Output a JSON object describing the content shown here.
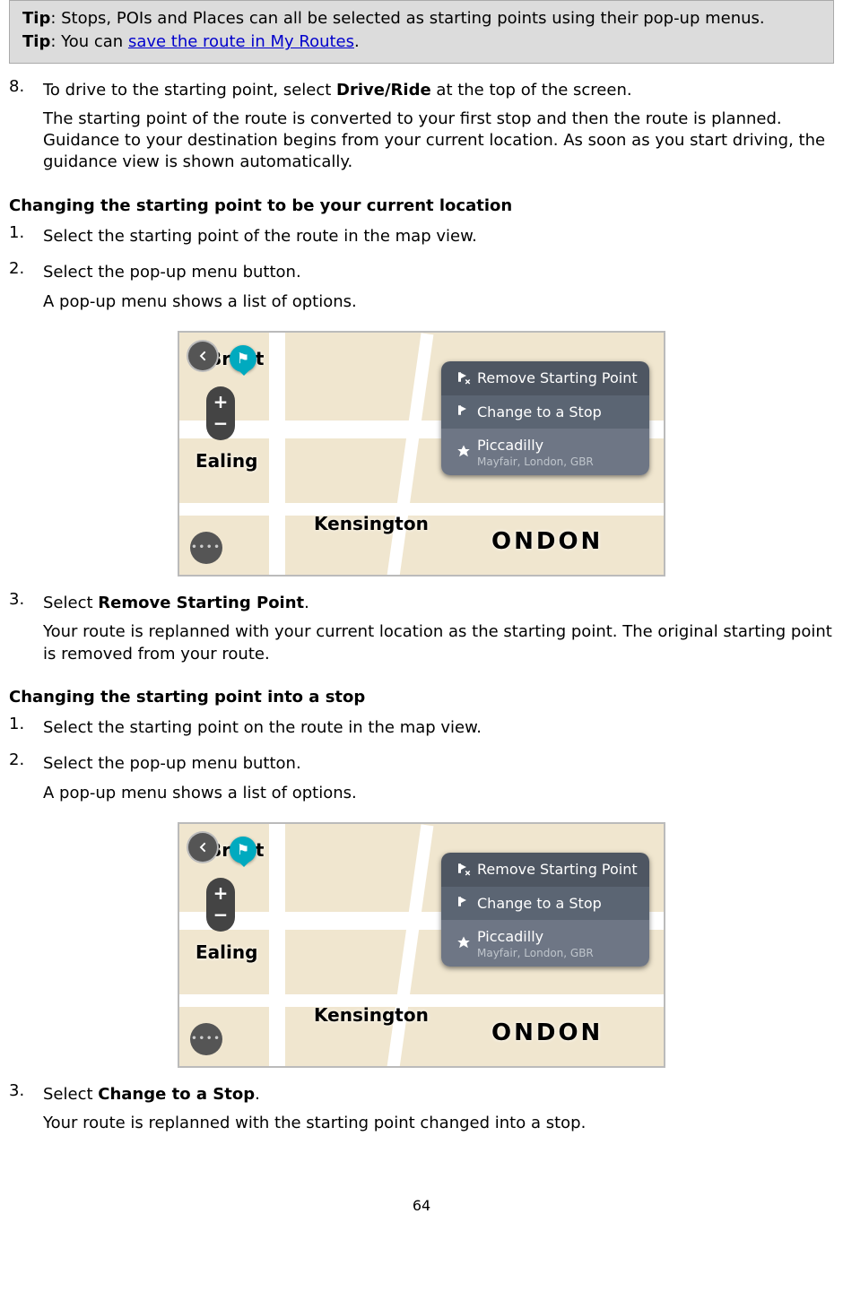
{
  "tips": {
    "label": "Tip",
    "line1_rest": ": Stops, POIs and Places can all be selected as starting points using their pop-up menus.",
    "line2_before": ": You can ",
    "line2_link": "save the route in My Routes",
    "line2_after": "."
  },
  "step8": {
    "marker": "8.",
    "line1_before": "To drive to the starting point, select ",
    "line1_bold": "Drive/Ride",
    "line1_after": " at the top of the screen.",
    "para": "The starting point of the route is converted to your first stop and then the route is planned. Guidance to your destination begins from your current location. As soon as you start driving, the guidance view is shown automatically."
  },
  "sectionA": {
    "heading": "Changing the starting point to be your current location",
    "s1": {
      "marker": "1.",
      "text": "Select the starting point of the route in the map view."
    },
    "s2": {
      "marker": "2.",
      "line1": "Select the pop-up menu button.",
      "line2": "A pop-up menu shows a list of options."
    },
    "s3": {
      "marker": "3.",
      "line1_before": "Select ",
      "line1_bold": "Remove Starting Point",
      "line1_after": ".",
      "para": "Your route is replanned with your current location as the starting point. The original starting point is removed from your route."
    }
  },
  "sectionB": {
    "heading": "Changing the starting point into a stop",
    "s1": {
      "marker": "1.",
      "text": "Select the starting point on the route in the map view."
    },
    "s2": {
      "marker": "2.",
      "line1": "Select the pop-up menu button.",
      "line2": "A pop-up menu shows a list of options."
    },
    "s3": {
      "marker": "3.",
      "line1_before": "Select ",
      "line1_bold": "Change to a Stop",
      "line1_after": ".",
      "para": "Your route is replanned with the starting point changed into a stop."
    }
  },
  "map": {
    "towns": {
      "brent": "Brent",
      "ealing": "Ealing",
      "kensington": "Kensington",
      "london": "ONDON"
    },
    "zoom_plus": "+",
    "zoom_minus": "−",
    "more": "••••",
    "popup": {
      "remove": "Remove Starting Point",
      "change": "Change to a Stop",
      "place_title": "Piccadilly",
      "place_sub": "Mayfair, London, GBR"
    }
  },
  "page_number": "64"
}
